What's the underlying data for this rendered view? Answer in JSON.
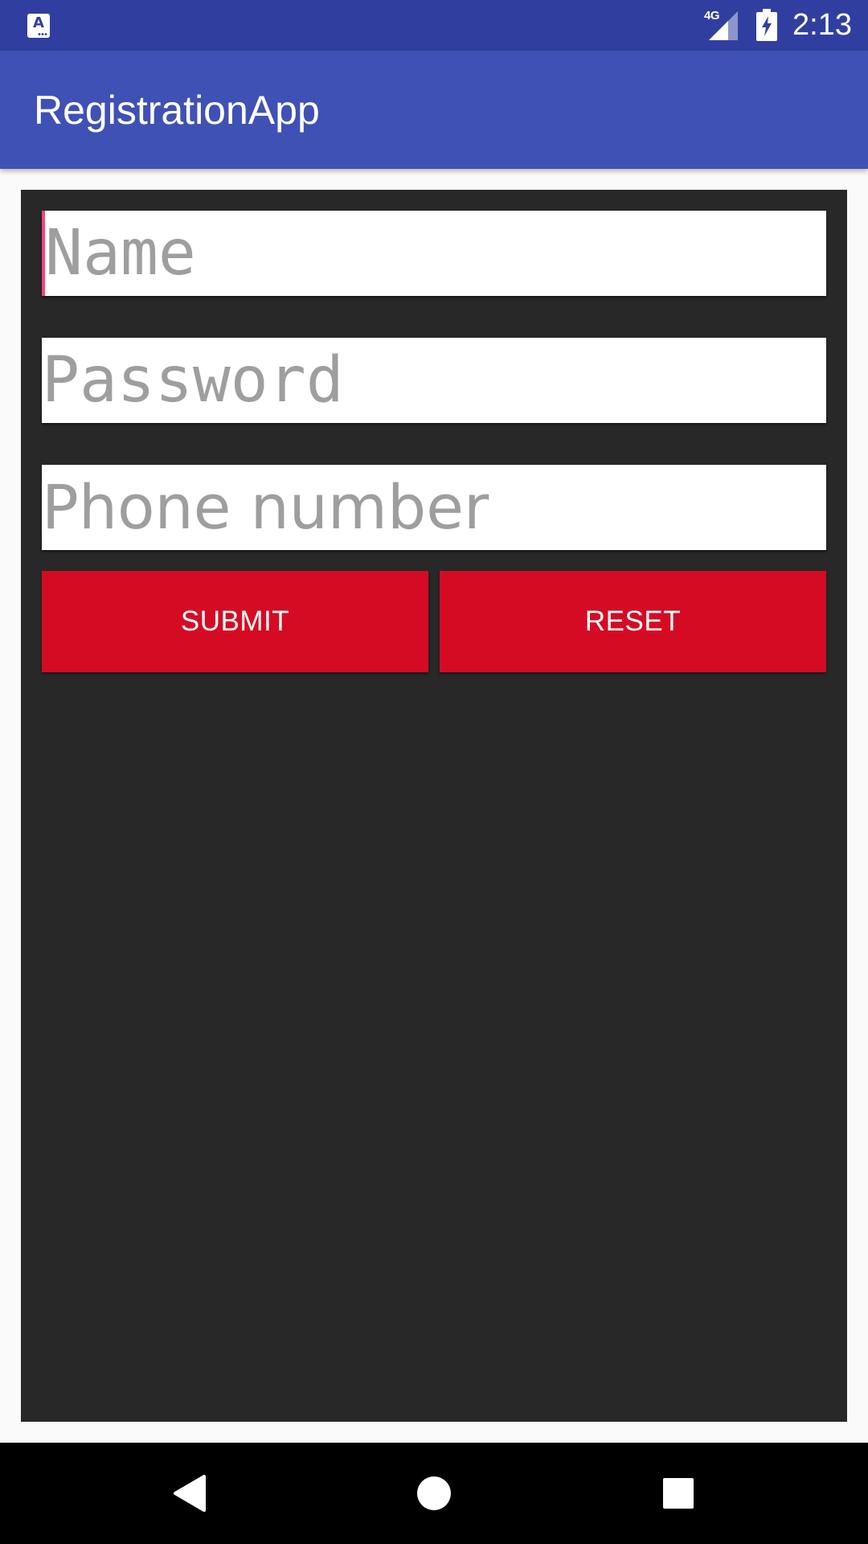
{
  "status_bar": {
    "left_icon": "accessibility-notification-icon",
    "left_icon_letter": "A",
    "network": "4G",
    "battery_icon": "battery-charging-icon",
    "time": "2:13",
    "color": "#303f9f"
  },
  "app_bar": {
    "title": "RegistrationApp",
    "color": "#3f51b5"
  },
  "form": {
    "background": "#282828",
    "name_field": {
      "value": "",
      "placeholder": "Name",
      "focused": true
    },
    "password_field": {
      "value": "",
      "placeholder": "Password"
    },
    "phone_field": {
      "value": "",
      "placeholder": "Phone number"
    },
    "submit_label": "SUBMIT",
    "reset_label": "RESET",
    "button_color": "#d50b24",
    "cursor_color": "#ff4081"
  },
  "nav_bar": {
    "back_icon": "back-triangle-icon",
    "home_icon": "home-circle-icon",
    "recent_icon": "recent-apps-square-icon"
  }
}
